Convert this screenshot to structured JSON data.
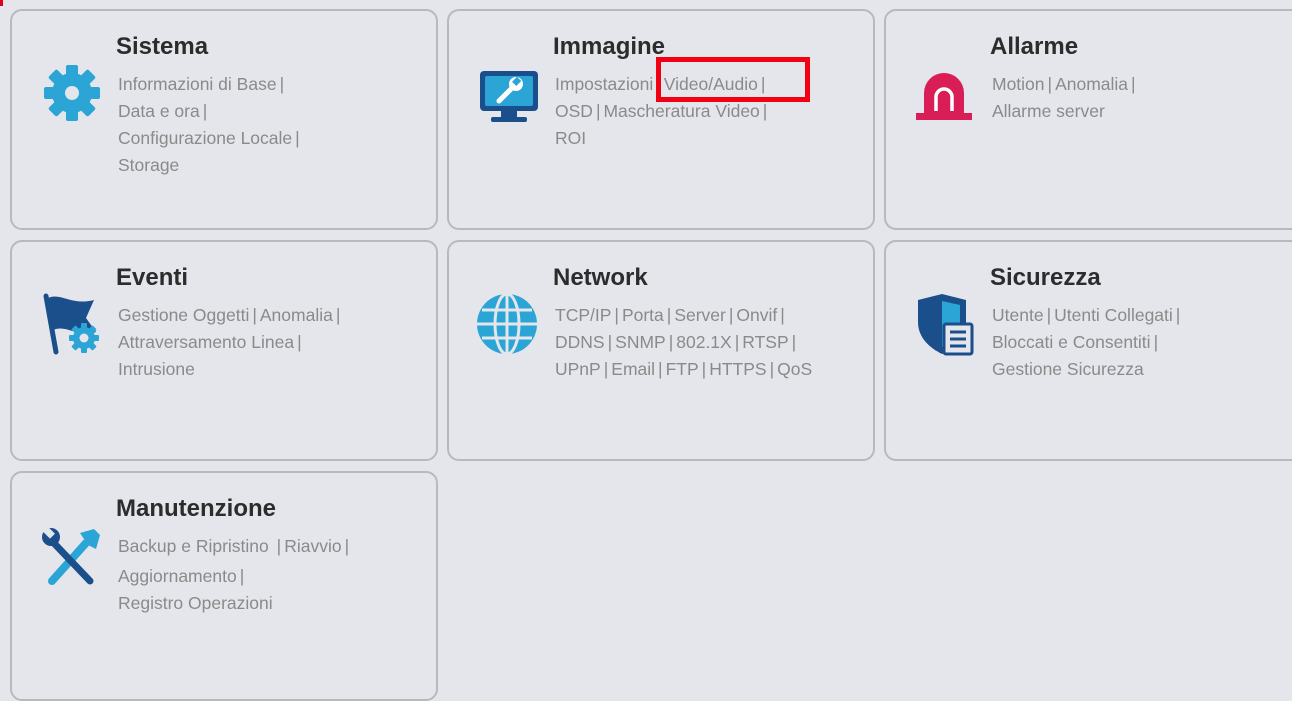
{
  "colors": {
    "background": "#e4e6eb",
    "title": "#2c2c2c",
    "link": "#8a8a8a",
    "icon_blue": "#2aa5d6",
    "icon_navy": "#1b4f8c",
    "alarm_red": "#d91d56",
    "highlight": "#f00012"
  },
  "cards": {
    "sistema": {
      "title": "Sistema",
      "icon": "gear-icon",
      "lines": [
        [
          "Informazioni di Base"
        ],
        [
          "Data e ora"
        ],
        [
          "Configurazione Locale"
        ],
        [
          "Storage"
        ]
      ]
    },
    "immagine": {
      "title": "Immagine",
      "icon": "monitor-wrench-icon",
      "lines": [
        [
          "Impostazioni",
          "Video/Audio"
        ],
        [
          "OSD",
          "Mascheratura Video"
        ],
        [
          "ROI"
        ]
      ]
    },
    "allarme": {
      "title": "Allarme",
      "icon": "alarm-siren-icon",
      "lines": [
        [
          "Motion",
          "Anomalia"
        ],
        [
          "Allarme server"
        ]
      ]
    },
    "eventi": {
      "title": "Eventi",
      "icon": "flag-gear-icon",
      "lines": [
        [
          "Gestione Oggetti",
          "Anomalia"
        ],
        [
          "Attraversamento Linea"
        ],
        [
          "Intrusione"
        ]
      ]
    },
    "network": {
      "title": "Network",
      "icon": "globe-icon",
      "lines": [
        [
          "TCP/IP",
          "Porta",
          "Server",
          "Onvif"
        ],
        [
          "DDNS",
          "SNMP",
          "802.1X",
          "RTSP"
        ],
        [
          "UPnP",
          "Email",
          "FTP",
          "HTTPS",
          "QoS"
        ]
      ]
    },
    "sicurezza": {
      "title": "Sicurezza",
      "icon": "shield-document-icon",
      "lines": [
        [
          "Utente",
          "Utenti Collegati"
        ],
        [
          "Bloccati e Consentiti"
        ],
        [
          "Gestione Sicurezza"
        ]
      ]
    },
    "manutenzione": {
      "title": "Manutenzione",
      "icon": "tools-icon",
      "lines": [
        [
          "Backup e Ripristino ",
          "Riavvio"
        ],
        [
          "Aggiornamento"
        ],
        [
          "Registro Operazioni"
        ]
      ]
    }
  },
  "separator": "|"
}
